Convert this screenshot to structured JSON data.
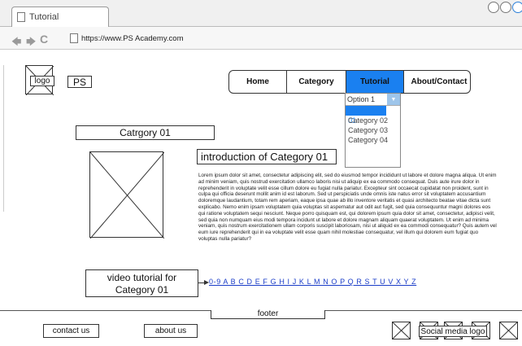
{
  "browser": {
    "tab_title": "Tutorial",
    "url": "https://www.PS Academy.com"
  },
  "header": {
    "logo_label": "logo",
    "brand": "PS"
  },
  "nav": {
    "items": [
      {
        "label": "Home"
      },
      {
        "label": "Category"
      },
      {
        "label": "Tutorial"
      },
      {
        "label": "About/Contact"
      }
    ],
    "dropdown": {
      "selected": "Option 1",
      "options": [
        "Category 01",
        "Category 02",
        "Category 03",
        "Category 04"
      ]
    }
  },
  "main": {
    "category_title": "Catrgory 01",
    "intro_title": "introduction of Category 01",
    "lorem": "Lorem ipsum dolor sit amet, consectetur adipiscing elit, sed do eiusmod tempor incididunt ut labore et dolore magna aliqua. Ut enim ad minim veniam, quis nostrud exercitation ullamco laboris nisi ut aliquip ex ea commodo consequat. Duis aute irure dolor in reprehenderit in voluptate velit esse cillum dolore eu fugiat nulla pariatur. Excepteur sint occaecat cupidatat non proident, sunt in culpa qui officia deserunt mollit anim id est laborum. Sed ut perspiciatis unde omnis iste natus error sit voluptatem accusantium doloremque laudantium, totam rem aperiam, eaque ipsa quae ab illo inventore veritatis et quasi architecto beatae vitae dicta sunt explicabo. Nemo enim ipsam voluptatem quia voluptas sit aspernatur aut odit aut fugit, sed quia consequuntur magni dolores eos qui ratione voluptatem sequi nesciunt. Neque porro quisquam est, qui dolorem ipsum quia dolor sit amet, consectetur, adipisci velit, sed quia non numquam eius modi tempora incidunt ut labore et dolore magnam aliquam quaerat voluptatem. Ut enim ad minima veniam, quis nostrum exercitationem ullam corporis suscipit laboriosam, nisi ut aliquid ex ea commodi consequatur? Quis autem vel eum iure reprehenderit qui in ea voluptate velit esse quam nihil molestiae consequatur, vel illum qui dolorem eum fugiat quo voluptas nulla pariatur?",
    "video_label_1": "video tutorial for",
    "video_label_2": "Category 01",
    "alphabet_index": "0-9 A B C D E F G H I J K L M N O P Q R S T U V X Y Z"
  },
  "footer": {
    "label": "footer",
    "contact": "contact us",
    "about": "about us",
    "social": "Social media logo"
  }
}
